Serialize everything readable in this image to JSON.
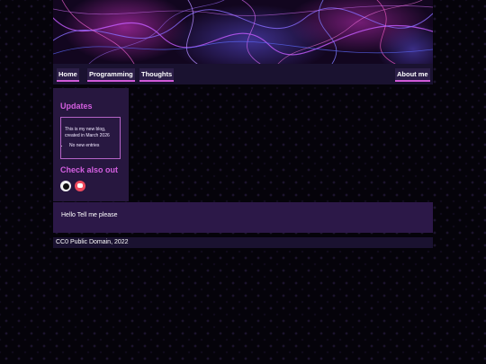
{
  "nav": {
    "home": "Home",
    "programming": "Programming",
    "thoughts": "Thoughts",
    "about": "About me"
  },
  "sidebar": {
    "updates_heading": "Updates",
    "updates_intro": "This is my new blog, created in March 2026",
    "updates_items": [
      "No new entries"
    ],
    "check_heading": "Check also out",
    "icons": [
      "github-icon",
      "mastodon-icon"
    ]
  },
  "main": {
    "text": "Hello Tell me please"
  },
  "footer": {
    "text": "CC0 Public Domain, 2022"
  },
  "colors": {
    "accent": "#d35fe0",
    "nav_bar": "#1a1230",
    "sidebar": "#27173f",
    "main_panel": "#2c1848"
  }
}
